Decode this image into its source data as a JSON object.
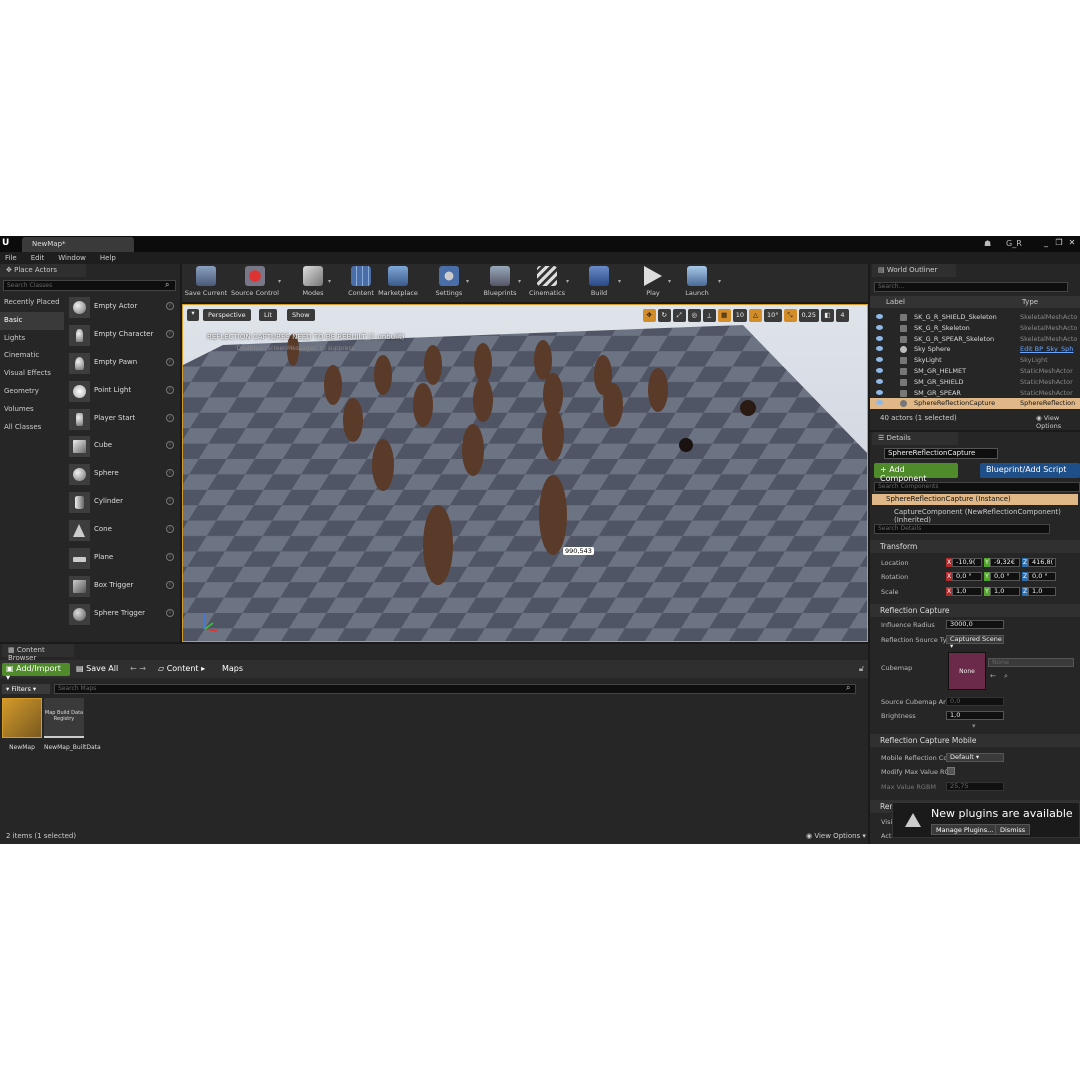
{
  "window": {
    "tab_title": "NewMap*",
    "user_tag": "G_R",
    "controls": [
      "_",
      "❐",
      "✕"
    ]
  },
  "menu": [
    "File",
    "Edit",
    "Window",
    "Help"
  ],
  "place_actors": {
    "tab": "Place Actors",
    "search_placeholder": "Search Classes",
    "categories": [
      "Recently Placed",
      "Basic",
      "Lights",
      "Cinematic",
      "Visual Effects",
      "Geometry",
      "Volumes",
      "All Classes"
    ],
    "active_category": "Basic",
    "actors": [
      "Empty Actor",
      "Empty Character",
      "Empty Pawn",
      "Point Light",
      "Player Start",
      "Cube",
      "Sphere",
      "Cylinder",
      "Cone",
      "Plane",
      "Box Trigger",
      "Sphere Trigger"
    ]
  },
  "toolbar": {
    "buttons": [
      "Save Current",
      "Source Control",
      "Modes",
      "Content",
      "Marketplace",
      "Settings",
      "Blueprints",
      "Cinematics",
      "Build",
      "Play",
      "Launch"
    ]
  },
  "viewport": {
    "perspective": "Perspective",
    "lit": "Lit",
    "show": "Show",
    "warning": "REFLECTION CAPTURES NEED TO BE REBUILT (1 unbuilt)",
    "warning_sub": "'DisableAllScreenMessages' to suppress",
    "snap_grid": "10",
    "snap_rot": "10°",
    "snap_scale": "0,25",
    "camera_speed": "4",
    "coord_label": "990,543"
  },
  "outliner": {
    "tab": "World Outliner",
    "search_placeholder": "Search...",
    "col_label": "Label",
    "col_type": "Type",
    "rows": [
      {
        "label": "SK_G_R_SHIELD_Skeleton",
        "type": "SkeletalMeshActo"
      },
      {
        "label": "SK_G_R_Skeleton",
        "type": "SkeletalMeshActo"
      },
      {
        "label": "SK_G_R_SPEAR_Skeleton",
        "type": "SkeletalMeshActo"
      },
      {
        "label": "Sky Sphere",
        "type": "Edit BP_Sky_Sph"
      },
      {
        "label": "SkyLight",
        "type": "SkyLight"
      },
      {
        "label": "SM_GR_HELMET",
        "type": "StaticMeshActor"
      },
      {
        "label": "SM_GR_SHIELD",
        "type": "StaticMeshActor"
      },
      {
        "label": "SM_GR_SPEAR",
        "type": "StaticMeshActor"
      },
      {
        "label": "SphereReflectionCapture",
        "type": "SphereReflection"
      }
    ],
    "status": "40 actors (1 selected)",
    "view_options": "View Options"
  },
  "details": {
    "tab": "Details",
    "actor_name": "SphereReflectionCapture",
    "add_component": "+ Add Component",
    "blueprint_script": "Blueprint/Add Script",
    "search_components": "Search Components",
    "instance": "SphereReflectionCapture (Instance)",
    "component": "CaptureComponent (NewReflectionComponent) (Inherited)",
    "search_details": "Search Details",
    "transform": {
      "title": "Transform",
      "location": {
        "label": "Location",
        "x": "-10,9(",
        "y": "-9,32€",
        "z": "416,8("
      },
      "rotation": {
        "label": "Rotation",
        "x": "0,0 °",
        "y": "0,0 °",
        "z": "0,0 °"
      },
      "scale": {
        "label": "Scale",
        "x": "1,0",
        "y": "1,0",
        "z": "1,0"
      }
    },
    "reflection": {
      "title": "Reflection Capture",
      "influence_label": "Influence Radius",
      "influence_value": "3000,0",
      "source_type_label": "Reflection Source Typ",
      "source_type_value": "Captured Scene",
      "cubemap_label": "Cubemap",
      "cubemap_value": "None",
      "cubemap_dropdown": "None",
      "angle_label": "Source Cubemap Angl",
      "angle_value": "0,0",
      "brightness_label": "Brightness",
      "brightness_value": "1,0"
    },
    "mobile": {
      "title": "Reflection Capture Mobile",
      "mobile_label": "Mobile Reflection Con",
      "mobile_value": "Default",
      "modify_label": "Modify Max Value RGI",
      "max_label": "Max Value RGBM",
      "max_value": "25,75"
    },
    "partial_section": "Ren",
    "partial_row1": "Visi",
    "partial_row2": "Actor Hidden in Game"
  },
  "notification": {
    "text": "New plugins are available",
    "manage": "Manage Plugins...",
    "dismiss": "Dismiss"
  },
  "content_browser": {
    "tab": "Content Browser",
    "add_import": "Add/Import",
    "save_all": "Save All",
    "path_content": "Content",
    "path_maps": "Maps",
    "filters": "Filters",
    "search_placeholder": "Search Maps",
    "assets": [
      {
        "name": "NewMap",
        "thumb_text": ""
      },
      {
        "name": "NewMap_BuiltData",
        "thumb_text": "Map Build Data Registry"
      }
    ],
    "status": "2 items (1 selected)",
    "view_options": "View Options"
  }
}
